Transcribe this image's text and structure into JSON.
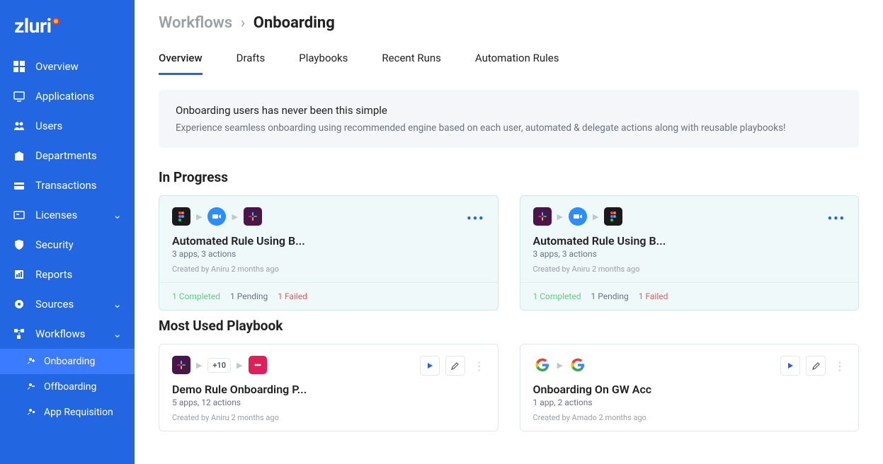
{
  "logo": "zluri",
  "sidebar": {
    "items": [
      {
        "label": "Overview"
      },
      {
        "label": "Applications"
      },
      {
        "label": "Users"
      },
      {
        "label": "Departments"
      },
      {
        "label": "Transactions"
      },
      {
        "label": "Licenses"
      },
      {
        "label": "Security"
      },
      {
        "label": "Reports"
      },
      {
        "label": "Sources"
      },
      {
        "label": "Workflows"
      }
    ],
    "sub": [
      {
        "label": "Onboarding"
      },
      {
        "label": "Offboarding"
      },
      {
        "label": "App Requisition"
      }
    ]
  },
  "breadcrumb": {
    "root": "Workflows",
    "current": "Onboarding"
  },
  "tabs": [
    "Overview",
    "Drafts",
    "Playbooks",
    "Recent Runs",
    "Automation Rules"
  ],
  "banner": {
    "title": "Onboarding users has never been this simple",
    "sub": "Experience seamless onboarding using recommended engine based on each user, automated & delegate actions along with reusable playbooks!"
  },
  "sections": {
    "in_progress": "In Progress",
    "most_used": "Most Used Playbook"
  },
  "progress_cards": [
    {
      "title": "Automated Rule Using B...",
      "meta": "3 apps, 3 actions",
      "created": "Created by Aniru 2 months ago",
      "completed": "1 Completed",
      "pending": "1 Pending",
      "failed": "1 Failed"
    },
    {
      "title": "Automated Rule Using B...",
      "meta": "3 apps, 3 actions",
      "created": "Created by Aniru 2 months ago",
      "completed": "1 Completed",
      "pending": "1 Pending",
      "failed": "1 Failed"
    }
  ],
  "playbook_cards": [
    {
      "title": "Demo Rule Onboarding P...",
      "meta": "5 apps, 12 actions",
      "created": "Created by Aniru 2 months ago",
      "plus": "+10"
    },
    {
      "title": "Onboarding On GW Acc",
      "meta": "1 app, 2 actions",
      "created": "Created by Amado 2 months ago"
    }
  ]
}
